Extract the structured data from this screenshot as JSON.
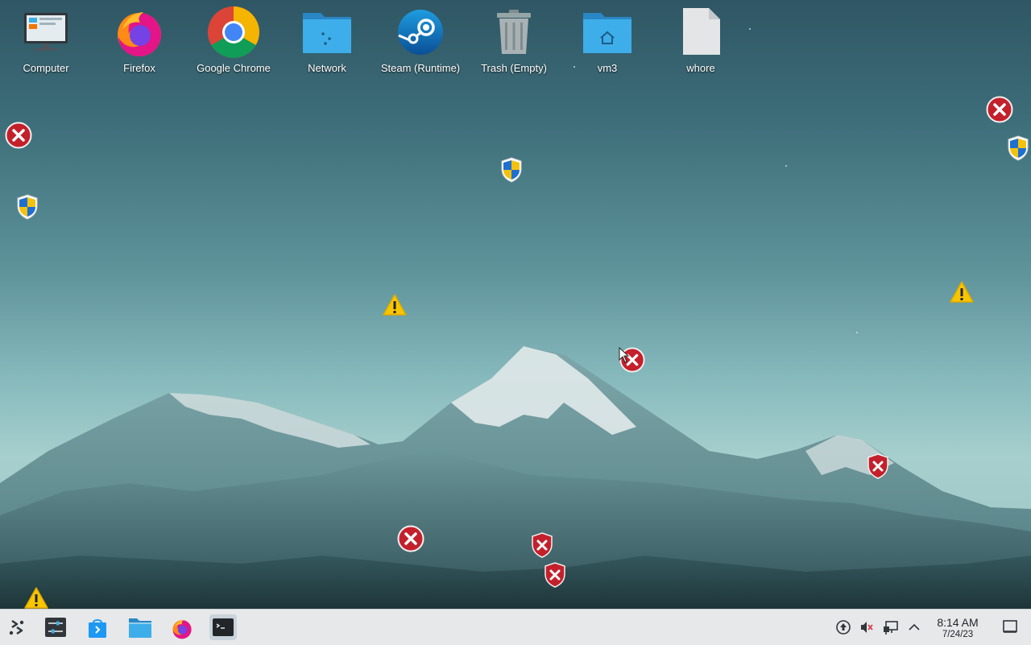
{
  "desktop_icons": [
    {
      "label": "Computer",
      "icon": "computer-icon"
    },
    {
      "label": "Firefox",
      "icon": "firefox-icon"
    },
    {
      "label": "Google Chrome",
      "icon": "chrome-icon"
    },
    {
      "label": "Network",
      "icon": "network-folder-icon"
    },
    {
      "label": "Steam (Runtime)",
      "icon": "steam-icon"
    },
    {
      "label": "Trash (Empty)",
      "icon": "trash-icon"
    },
    {
      "label": "vm3",
      "icon": "home-folder-icon"
    },
    {
      "label": "whore",
      "icon": "file-icon"
    }
  ],
  "taskbar": {
    "launcher": "application-launcher-icon",
    "items": [
      "system-settings-icon",
      "discover-store-icon",
      "dolphin-files-icon",
      "firefox-icon",
      "konsole-terminal-icon"
    ],
    "active_item": "konsole-terminal-icon",
    "tray": [
      "update-notifier-icon",
      "volume-muted-icon",
      "network-icon",
      "expand-tray-icon"
    ],
    "clock": {
      "time": "8:14 AM",
      "date": "7/24/23"
    },
    "show_desktop": "show-desktop-icon"
  },
  "overlay_icons": [
    "error-icon",
    "uac-shield-icon",
    "warning-icon",
    "error-shield-icon"
  ],
  "colors": {
    "sky_top": "#2f5664",
    "sky_bottom": "#a6cfcd",
    "taskbar_bg": "#e6e8ea",
    "error_red": "#c4202b",
    "folder_blue": "#3daee9"
  }
}
